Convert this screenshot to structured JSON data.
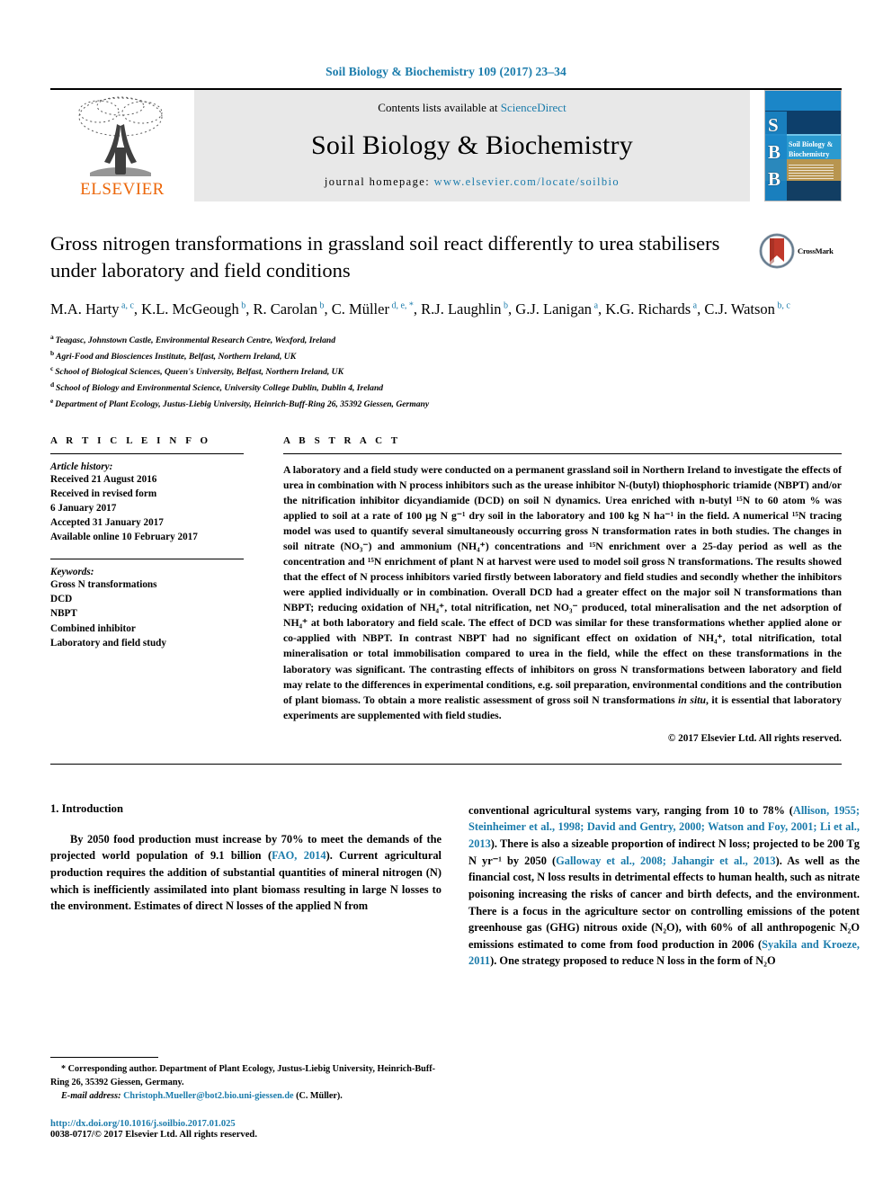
{
  "running_head": "Soil Biology & Biochemistry 109 (2017) 23–34",
  "masthead": {
    "contents_prefix": "Contents lists available at ",
    "sciencedirect": "ScienceDirect",
    "journal_name": "Soil Biology & Biochemistry",
    "homepage_label": "journal homepage: ",
    "homepage_url": "www.elsevier.com/locate/soilbio",
    "publisher_wordmark": "ELSEVIER",
    "cover": {
      "letters": [
        "S",
        "B",
        "B"
      ],
      "title_line1": "Soil Biology &",
      "title_line2": "Biochemistry"
    },
    "accent_color": "#1a7bab",
    "elsevier_orange": "#ec6608",
    "cover_blue": "#1b86c8"
  },
  "article": {
    "title": "Gross nitrogen transformations in grassland soil react differently to urea stabilisers under laboratory and field conditions",
    "crossmark_label": "CrossMark",
    "authors": [
      {
        "name": "M.A. Harty",
        "marks": "a, c"
      },
      {
        "name": "K.L. McGeough",
        "marks": "b"
      },
      {
        "name": "R. Carolan",
        "marks": "b"
      },
      {
        "name": "C. Müller",
        "marks": "d, e, *"
      },
      {
        "name": "R.J. Laughlin",
        "marks": "b"
      },
      {
        "name": "G.J. Lanigan",
        "marks": "a"
      },
      {
        "name": "K.G. Richards",
        "marks": "a"
      },
      {
        "name": "C.J. Watson",
        "marks": "b, c"
      }
    ],
    "affiliations": [
      {
        "mark": "a",
        "text": "Teagasc, Johnstown Castle, Environmental Research Centre, Wexford, Ireland"
      },
      {
        "mark": "b",
        "text": "Agri-Food and Biosciences Institute, Belfast, Northern Ireland, UK"
      },
      {
        "mark": "c",
        "text": "School of Biological Sciences, Queen's University, Belfast, Northern Ireland, UK"
      },
      {
        "mark": "d",
        "text": "School of Biology and Environmental Science, University College Dublin, Dublin 4, Ireland"
      },
      {
        "mark": "e",
        "text": "Department of Plant Ecology, Justus-Liebig University, Heinrich-Buff-Ring 26, 35392 Giessen, Germany"
      }
    ]
  },
  "article_info": {
    "heading": "A R T I C L E   I N F O",
    "history_label": "Article history:",
    "history": [
      "Received 21 August 2016",
      "Received in revised form",
      "6 January 2017",
      "Accepted 31 January 2017",
      "Available online 10 February 2017"
    ],
    "keywords_label": "Keywords:",
    "keywords": [
      "Gross N transformations",
      "DCD",
      "NBPT",
      "Combined inhibitor",
      "Laboratory and field study"
    ]
  },
  "abstract": {
    "heading": "A B S T R A C T",
    "paragraphs": [
      "A laboratory and a field study were conducted on a permanent grassland soil in Northern Ireland to investigate the effects of urea in combination with N process inhibitors such as the urease inhibitor N-(butyl) thiophosphoric triamide (NBPT) and/or the nitrification inhibitor dicyandiamide (DCD) on soil N dynamics. Urea enriched with n-butyl ¹⁵N to 60 atom % was applied to soil at a rate of 100 μg N g⁻¹ dry soil in the laboratory and 100 kg N ha⁻¹ in the field. A numerical ¹⁵N tracing model was used to quantify several simultaneously occurring gross N transformation rates in both studies. The changes in soil nitrate (NO₃⁻) and ammonium (NH₄⁺) concentrations and ¹⁵N enrichment over a 25-day period as well as the concentration and ¹⁵N enrichment of plant N at harvest were used to model soil gross N transformations. The results showed that the effect of N process inhibitors varied firstly between laboratory and field studies and secondly whether the inhibitors were applied individually or in combination. Overall DCD had a greater effect on the major soil N transformations than NBPT; reducing oxidation of NH₄⁺, total nitrification, net NO₃⁻ produced, total mineralisation and the net adsorption of NH₄⁺ at both laboratory and field scale. The effect of DCD was similar for these transformations whether applied alone or co-applied with NBPT. In contrast NBPT had no significant effect on oxidation of NH₄⁺, total nitrification, total mineralisation or total immobilisation compared to urea in the field, while the effect on these transformations in the laboratory was significant. The contrasting effects of inhibitors on gross N transformations between laboratory and field may relate to the differences in experimental conditions, e.g. soil preparation, environmental conditions and the contribution of plant biomass. To obtain a more realistic assessment of gross soil N transformations in situ, it is essential that laboratory experiments are supplemented with field studies."
    ],
    "copyright": "© 2017 Elsevier Ltd. All rights reserved."
  },
  "introduction": {
    "heading": "1. Introduction",
    "left_paragraph": "By 2050 food production must increase by 70% to meet the demands of the projected world population of 9.1 billion (FAO, 2014). Current agricultural production requires the addition of substantial quantities of mineral nitrogen (N) which is inefficiently assimilated into plant biomass resulting in large N losses to the environment. Estimates of direct N losses of the applied N from",
    "right_paragraph": "conventional agricultural systems vary, ranging from 10 to 78% (Allison, 1955; Steinheimer et al., 1998; David and Gentry, 2000; Watson and Foy, 2001; Li et al., 2013). There is also a sizeable proportion of indirect N loss; projected to be 200 Tg N yr⁻¹ by 2050 (Galloway et al., 2008; Jahangir et al., 2013). As well as the financial cost, N loss results in detrimental effects to human health, such as nitrate poisoning increasing the risks of cancer and birth defects, and the environment. There is a focus in the agriculture sector on controlling emissions of the potent greenhouse gas (GHG) nitrous oxide (N₂O), with 60% of all anthropogenic N₂O emissions estimated to come from food production in 2006 (Syakila and Kroeze, 2011). One strategy proposed to reduce N loss in the form of N₂O",
    "citations_left": [
      "FAO, 2014"
    ],
    "citations_right": [
      "Allison, 1955; Steinheimer et al., 1998; David and Gentry, 2000; Watson and Foy, 2001; Li et al., 2013",
      "Galloway et al., 2008; Jahangir et al., 2013",
      "Syakila and Kroeze, 2011"
    ]
  },
  "footnotes": {
    "corresponding": "* Corresponding author. Department of Plant Ecology, Justus-Liebig University, Heinrich-Buff-Ring 26, 35392 Giessen, Germany.",
    "email_label": "E-mail address:",
    "email": "Christoph.Mueller@bot2.bio.uni-giessen.de",
    "email_suffix": "(C. Müller).",
    "doi": "http://dx.doi.org/10.1016/j.soilbio.2017.01.025",
    "issn_line": "0038-0717/© 2017 Elsevier Ltd. All rights reserved."
  }
}
